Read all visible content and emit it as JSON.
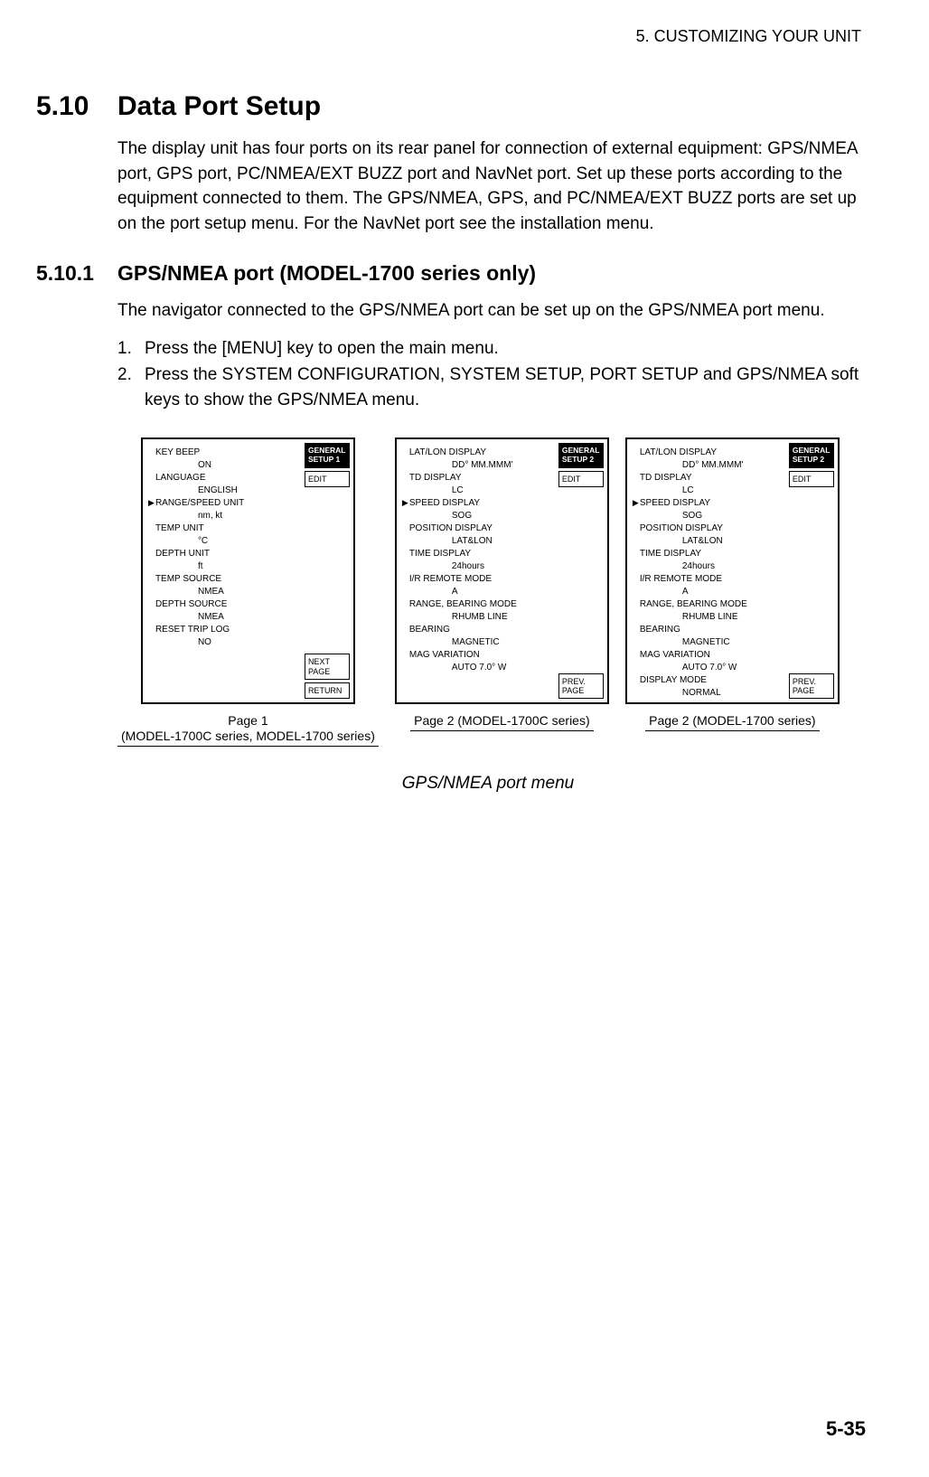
{
  "chapter_header": "5. CUSTOMIZING YOUR UNIT",
  "section": {
    "num": "5.10",
    "title": "Data Port Setup"
  },
  "intro": "The display unit has four ports on its rear panel for connection of external equipment: GPS/NMEA port, GPS port, PC/NMEA/EXT BUZZ port and NavNet port. Set up these ports according to the equipment connected to them. The GPS/NMEA, GPS, and PC/NMEA/EXT BUZZ ports are set up on the port setup menu. For the NavNet port see the installation menu.",
  "subsection": {
    "num": "5.10.1",
    "title": "GPS/NMEA port (MODEL-1700 series only)"
  },
  "sub_intro": "The navigator connected to the GPS/NMEA port can be set up on the GPS/NMEA port menu.",
  "steps": [
    {
      "n": "1.",
      "t": "Press the [MENU] key to open the main menu."
    },
    {
      "n": "2.",
      "t": "Press the SYSTEM CONFIGURATION, SYSTEM SETUP, PORT SETUP and GPS/NMEA soft keys to show the GPS/NMEA menu."
    }
  ],
  "screens": [
    {
      "title_black": "GENERAL\nSETUP 1",
      "softkeys_top": [
        "EDIT"
      ],
      "softkeys_bot": [
        "NEXT\nPAGE",
        "RETURN"
      ],
      "selected_idx": 2,
      "items": [
        {
          "label": "KEY BEEP",
          "value": "ON"
        },
        {
          "label": "LANGUAGE",
          "value": "ENGLISH"
        },
        {
          "label": "RANGE/SPEED UNIT",
          "value": "nm, kt"
        },
        {
          "label": "TEMP UNIT",
          "value": "°C"
        },
        {
          "label": "DEPTH UNIT",
          "value": "ft"
        },
        {
          "label": "TEMP SOURCE",
          "value": "NMEA"
        },
        {
          "label": "DEPTH SOURCE",
          "value": "NMEA"
        },
        {
          "label": "RESET TRIP LOG",
          "value": "NO"
        }
      ],
      "caption": "Page 1\n(MODEL-1700C series, MODEL-1700 series)"
    },
    {
      "title_black": "GENERAL\nSETUP 2",
      "softkeys_top": [
        "EDIT"
      ],
      "softkeys_bot": [
        "PREV.\nPAGE"
      ],
      "selected_idx": 2,
      "items": [
        {
          "label": "LAT/LON DISPLAY",
          "value": "DD° MM.MMM'"
        },
        {
          "label": "TD DISPLAY",
          "value": "LC"
        },
        {
          "label": "SPEED DISPLAY",
          "value": "SOG"
        },
        {
          "label": "POSITION DISPLAY",
          "value": "LAT&LON"
        },
        {
          "label": "TIME DISPLAY",
          "value": "24hours"
        },
        {
          "label": "I/R REMOTE MODE",
          "value": "A"
        },
        {
          "label": "RANGE, BEARING MODE",
          "value": "RHUMB LINE"
        },
        {
          "label": "BEARING",
          "value": "MAGNETIC"
        },
        {
          "label": "MAG VARIATION",
          "value": "AUTO 7.0° W"
        }
      ],
      "caption": "Page 2 (MODEL-1700C series)"
    },
    {
      "title_black": "GENERAL\nSETUP 2",
      "softkeys_top": [
        "EDIT"
      ],
      "softkeys_bot": [
        "PREV.\nPAGE"
      ],
      "selected_idx": 2,
      "items": [
        {
          "label": "LAT/LON DISPLAY",
          "value": "DD° MM.MMM'"
        },
        {
          "label": "TD DISPLAY",
          "value": "LC"
        },
        {
          "label": "SPEED DISPLAY",
          "value": "SOG"
        },
        {
          "label": "POSITION DISPLAY",
          "value": "LAT&LON"
        },
        {
          "label": "TIME DISPLAY",
          "value": "24hours"
        },
        {
          "label": "I/R REMOTE MODE",
          "value": "A"
        },
        {
          "label": "RANGE, BEARING MODE",
          "value": "RHUMB LINE"
        },
        {
          "label": "BEARING",
          "value": "MAGNETIC"
        },
        {
          "label": "MAG VARIATION",
          "value": "AUTO 7.0° W"
        },
        {
          "label": "DISPLAY MODE",
          "value": "NORMAL"
        }
      ],
      "caption": "Page 2 (MODEL-1700 series)"
    }
  ],
  "figure_caption": "GPS/NMEA port menu",
  "page_number": "5-35"
}
